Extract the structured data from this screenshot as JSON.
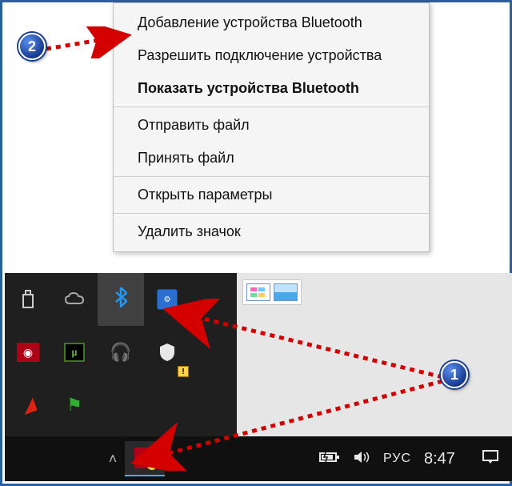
{
  "context_menu": {
    "items": [
      {
        "label": "Добавление устройства Bluetooth",
        "bold": false
      },
      {
        "label": "Разрешить подключение устройства",
        "bold": false
      },
      {
        "label": "Показать устройства Bluetooth",
        "bold": true
      }
    ],
    "group2": [
      {
        "label": "Отправить файл"
      },
      {
        "label": "Принять файл"
      }
    ],
    "group3": [
      {
        "label": "Открыть параметры"
      }
    ],
    "group4": [
      {
        "label": "Удалить значок"
      }
    ]
  },
  "tray": {
    "icons": {
      "usb": "usb-drive-icon",
      "onedrive": "cloud-icon",
      "bluetooth": "bluetooth-icon",
      "intel": "intel-graphics-icon",
      "camera": "camera-icon",
      "utorrent": "µ",
      "headphones": "headphones-icon",
      "security": "windows-security-icon",
      "red_app": "red-app-icon",
      "flag": "flag-icon"
    }
  },
  "taskbar": {
    "language": "РУС",
    "time": "8:47",
    "chevron": "˄"
  },
  "callouts": {
    "c1": "1",
    "c2": "2"
  }
}
